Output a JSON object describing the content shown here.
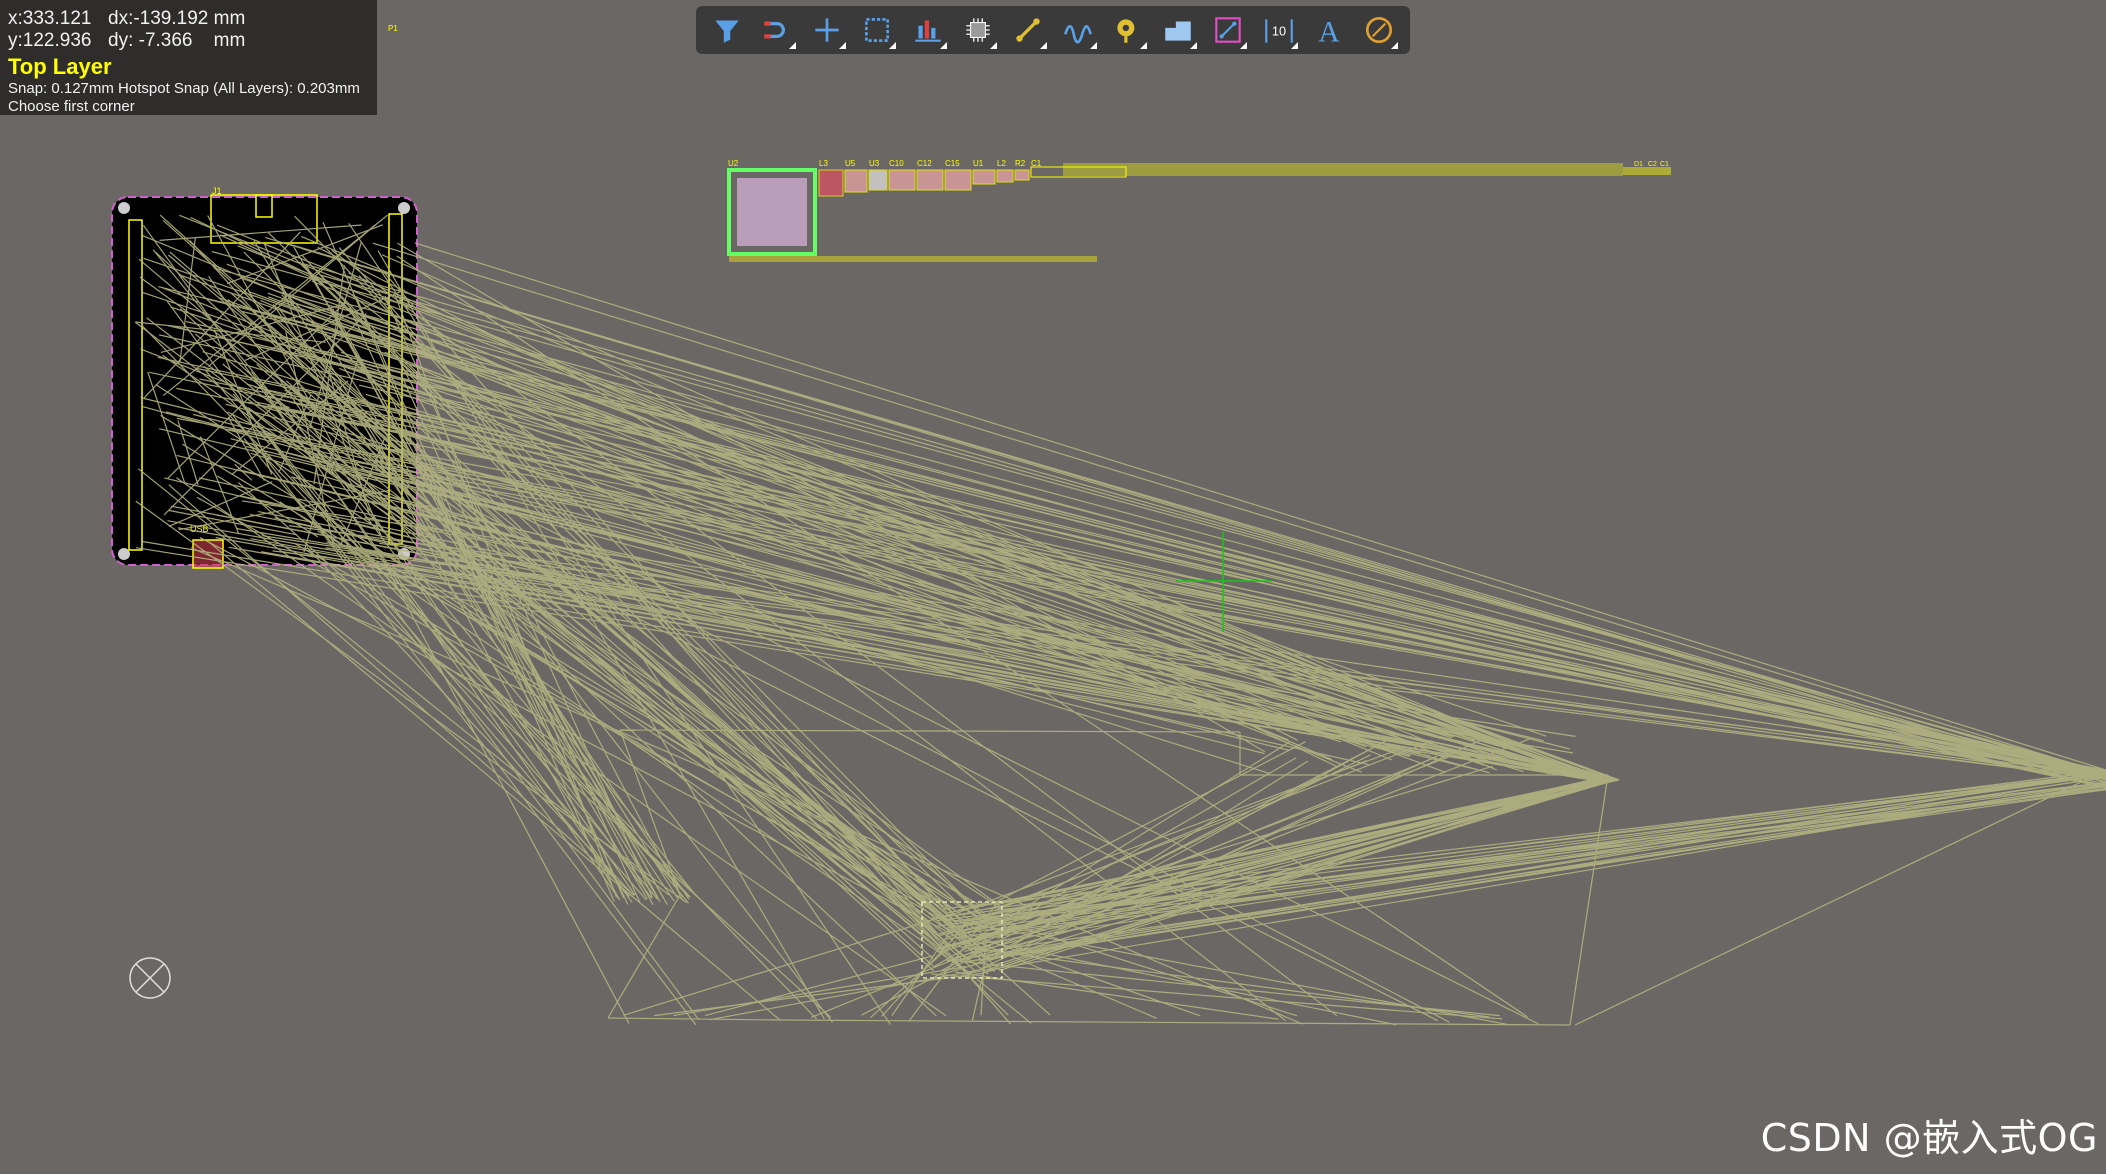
{
  "hud": {
    "x_label": "x:333.121",
    "dx_label": "dx:-139.192 mm",
    "y_label": "y:122.936",
    "dy_label": "dy: -7.366    mm",
    "layer": "Top Layer",
    "snap": "Snap: 0.127mm Hotspot Snap (All Layers): 0.203mm",
    "hint": "Choose first corner"
  },
  "toolbar": {
    "tools": [
      {
        "icon": "filter-icon"
      },
      {
        "icon": "interactive-snap-icon"
      },
      {
        "icon": "crosshair-plus-icon"
      },
      {
        "icon": "select-rect-icon"
      },
      {
        "icon": "align-icon"
      },
      {
        "icon": "component-icon"
      },
      {
        "icon": "route-track-icon"
      },
      {
        "icon": "diff-pair-icon"
      },
      {
        "icon": "via-icon"
      },
      {
        "icon": "polygon-fill-icon"
      },
      {
        "icon": "keepout-icon"
      },
      {
        "icon": "dimension-icon"
      },
      {
        "icon": "text-string-icon"
      },
      {
        "icon": "arc-icon"
      }
    ],
    "text_tool_glyph": "A",
    "dimension_glyph": "10"
  },
  "board": {
    "connector_label": "J1",
    "usb_label": "USB",
    "page_marker": "P1"
  },
  "components": {
    "u2_label": "U2",
    "row_labels": [
      "L3",
      "U5",
      "U3",
      "C10",
      "C12",
      "C15",
      "U1",
      "L2",
      "R2",
      "C1"
    ],
    "right_labels": [
      "D1",
      "C2",
      "C1"
    ]
  },
  "colors": {
    "background": "#6b6764",
    "ratsnest": "#b4b482",
    "silkscreen": "#ffff00",
    "board_outline": "#c850c8",
    "cursor": "#14c814",
    "selection": "#64ff64"
  },
  "watermark": "CSDN @嵌入式OG"
}
